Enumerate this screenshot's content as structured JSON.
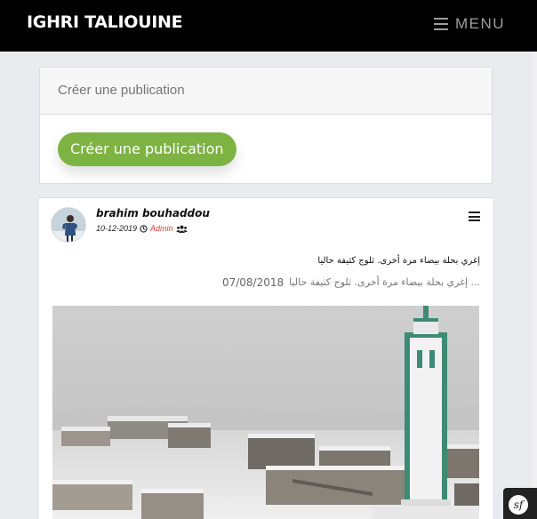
{
  "header": {
    "brand": "IGHRI TALIOUINE",
    "menu_label": "MENU",
    "menu_icon": "hamburger-icon"
  },
  "create_card": {
    "placeholder": "Créer une publication",
    "button_label": "Créer une publication",
    "accent": "#7cb342"
  },
  "post": {
    "author": "brahim bouhaddou",
    "date": "10-12-2019",
    "role": "Admin",
    "role_color": "#e53935",
    "visibility_icon": "users-icon",
    "time_icon": "clock-icon",
    "menu_icon": "hamburger-icon",
    "caption": "إغري بحلة بيضاء مرة أخرى. ثلوج كثيفة حاليا",
    "sub_text": "... إغري بحلة بيضاء مرة أخرى. ثلوج كثيفة حاليا",
    "sub_date": "07/08/2018"
  },
  "footer_badge": {
    "icon": "symfony-icon",
    "label": "sf"
  }
}
